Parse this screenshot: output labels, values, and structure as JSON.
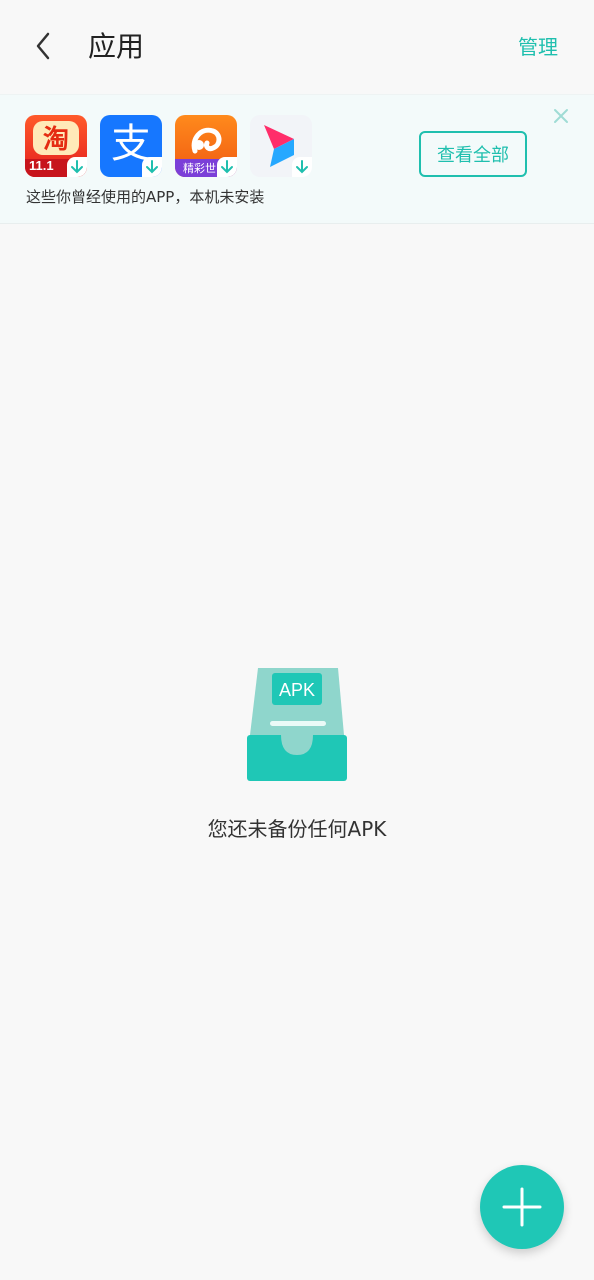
{
  "header": {
    "title": "应用",
    "manage_label": "管理"
  },
  "banner": {
    "description": "这些你曾经使用的APP，本机未安装",
    "view_all_label": "查看全部",
    "apps": [
      {
        "name": "taobao-app",
        "badge_text": "11.1"
      },
      {
        "name": "alipay-app",
        "glyph": "支"
      },
      {
        "name": "uc-browser-app",
        "badge_text": "精彩世"
      },
      {
        "name": "video-app"
      }
    ]
  },
  "empty_state": {
    "apk_label": "APK",
    "message": "您还未备份任何APK"
  },
  "colors": {
    "accent": "#1fbfae",
    "fab": "#1fc7b6",
    "background": "#f8f8f8"
  }
}
